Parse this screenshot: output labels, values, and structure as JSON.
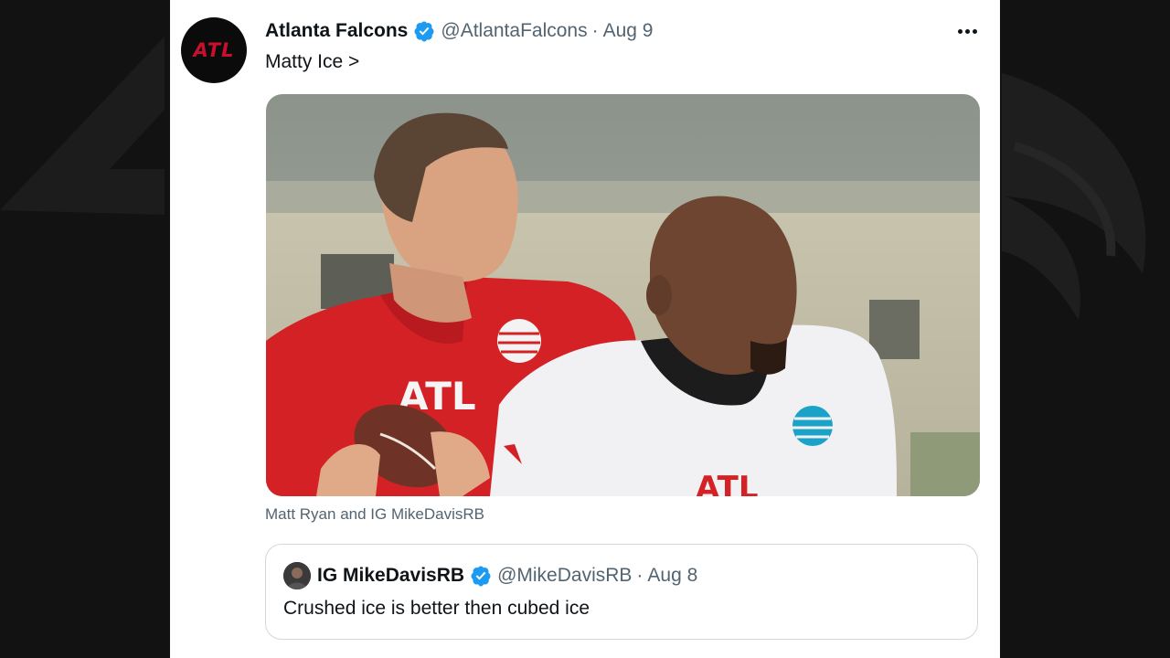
{
  "tweet": {
    "author_name": "Atlanta Falcons",
    "author_handle": "@AtlantaFalcons",
    "separator": "·",
    "date": "Aug 9",
    "text": "Matty Ice >",
    "avatar_text": "ATL",
    "media_caption": "Matt Ryan and IG MikeDavisRB",
    "more_icon": "more-horizontal-icon"
  },
  "quoted_tweet": {
    "author_name": "IG MikeDavisRB",
    "author_handle": "@MikeDavisRB",
    "separator": "·",
    "date": "Aug 8",
    "text": "Crushed ice is better then cubed ice"
  },
  "media": {
    "jersey_text_red": "ATL",
    "jersey_text_white": "ATL"
  },
  "colors": {
    "verified_blue": "#1d9bf0",
    "falcons_red": "#c8102e",
    "secondary_text": "#536471",
    "primary_text": "#0f1419"
  }
}
